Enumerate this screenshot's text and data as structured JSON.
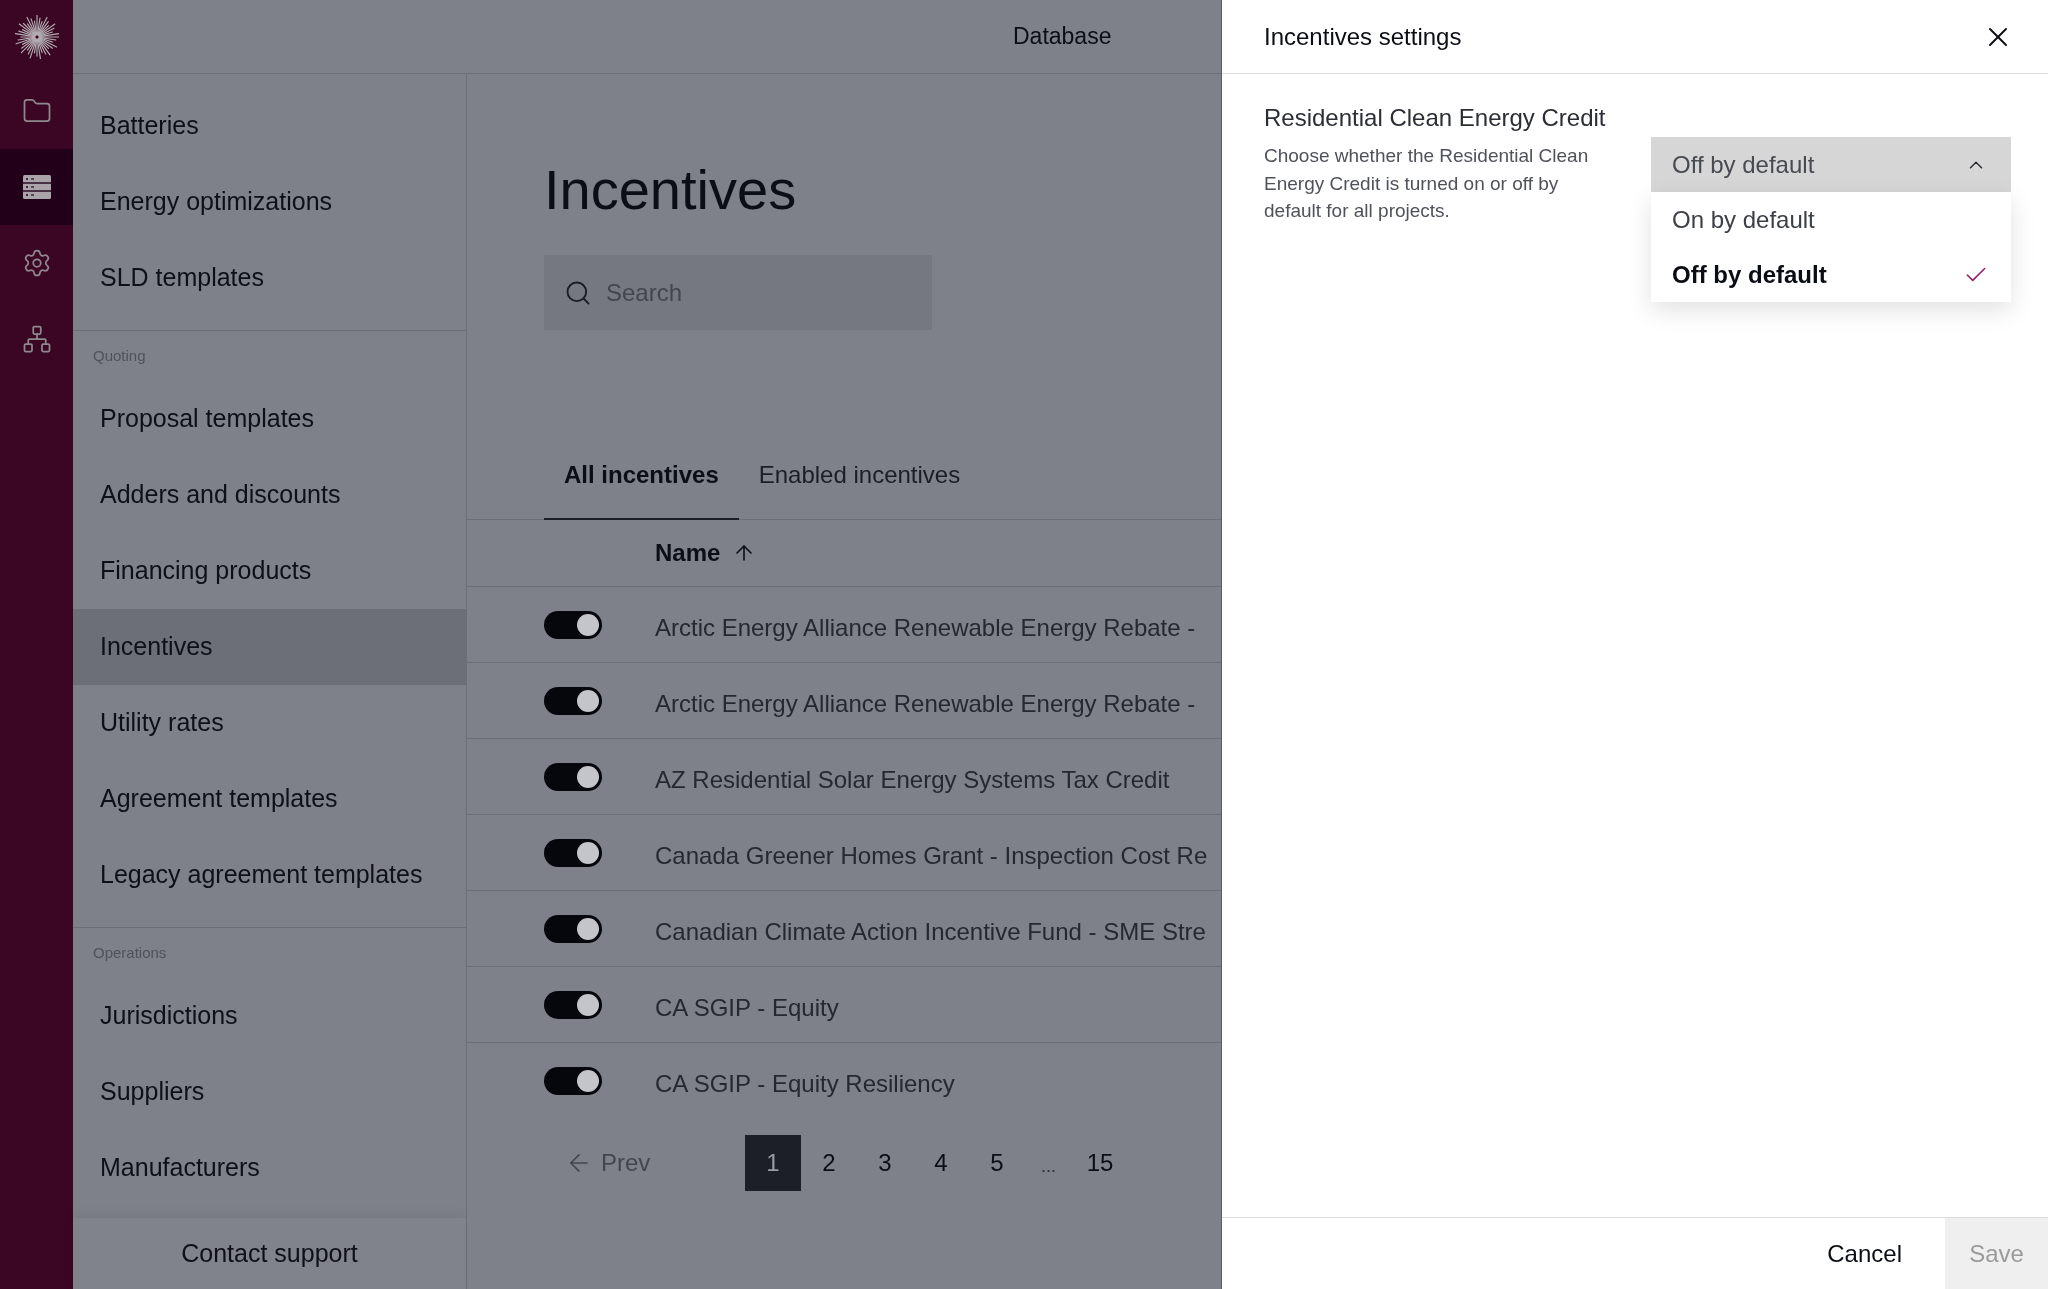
{
  "rail": {
    "items": [
      {
        "selected": false
      },
      {
        "selected": true
      },
      {
        "selected": false
      },
      {
        "selected": false
      }
    ]
  },
  "top_bar": {
    "title": "Database"
  },
  "sidebar": {
    "sections": [
      {
        "items": [
          {
            "label": "Batteries",
            "selected": false
          },
          {
            "label": "Energy optimizations",
            "selected": false
          },
          {
            "label": "SLD templates",
            "selected": false
          }
        ]
      },
      {
        "heading": "Quoting",
        "items": [
          {
            "label": "Proposal templates",
            "selected": false
          },
          {
            "label": "Adders and discounts",
            "selected": false
          },
          {
            "label": "Financing products",
            "selected": false
          },
          {
            "label": "Incentives",
            "selected": true
          },
          {
            "label": "Utility rates",
            "selected": false
          },
          {
            "label": "Agreement templates",
            "selected": false
          },
          {
            "label": "Legacy agreement templates",
            "selected": false
          }
        ]
      },
      {
        "heading": "Operations",
        "items": [
          {
            "label": "Jurisdictions",
            "selected": false
          },
          {
            "label": "Suppliers",
            "selected": false
          },
          {
            "label": "Manufacturers",
            "selected": false
          }
        ]
      }
    ],
    "footer": {
      "label": "Contact support"
    }
  },
  "page": {
    "title": "Incentives",
    "search": {
      "placeholder": "Search"
    },
    "tabs": [
      {
        "label": "All incentives",
        "selected": true
      },
      {
        "label": "Enabled incentives",
        "selected": false
      }
    ],
    "table": {
      "columns": [
        {
          "label": "Name",
          "sort_ascending": true
        }
      ],
      "rows": [
        {
          "enabled": true,
          "name": "Arctic Energy Alliance Renewable Energy Rebate -"
        },
        {
          "enabled": true,
          "name": "Arctic Energy Alliance Renewable Energy Rebate -"
        },
        {
          "enabled": true,
          "name": "AZ Residential Solar Energy Systems Tax Credit"
        },
        {
          "enabled": true,
          "name": "Canada Greener Homes Grant - Inspection Cost Re"
        },
        {
          "enabled": true,
          "name": "Canadian Climate Action Incentive Fund - SME Stre"
        },
        {
          "enabled": true,
          "name": "CA SGIP - Equity"
        },
        {
          "enabled": true,
          "name": "CA SGIP - Equity Resiliency"
        }
      ]
    },
    "pagination": {
      "prev": {
        "label": "Prev",
        "disabled": true
      },
      "pages": [
        {
          "kind": "page",
          "label": "1",
          "selected": true
        },
        {
          "kind": "page",
          "label": "2",
          "selected": false
        },
        {
          "kind": "page",
          "label": "3",
          "selected": false
        },
        {
          "kind": "page",
          "label": "4",
          "selected": false
        },
        {
          "kind": "page",
          "label": "5",
          "selected": false
        },
        {
          "kind": "gap",
          "label": "..."
        },
        {
          "kind": "page",
          "label": "15",
          "selected": false
        }
      ]
    }
  },
  "panel": {
    "title": "Incentives settings",
    "setting": {
      "title": "Residential Clean Energy Credit",
      "description": "Choose whether the Residential Clean Energy Credit is turned on or off by default for all projects.",
      "select": {
        "value": "Off by default",
        "expanded": true,
        "options": [
          {
            "label": "On by default",
            "selected": false
          },
          {
            "label": "Off by default",
            "selected": true
          }
        ]
      }
    },
    "footer": {
      "cancel": "Cancel",
      "save": {
        "label": "Save",
        "disabled": true
      }
    }
  }
}
